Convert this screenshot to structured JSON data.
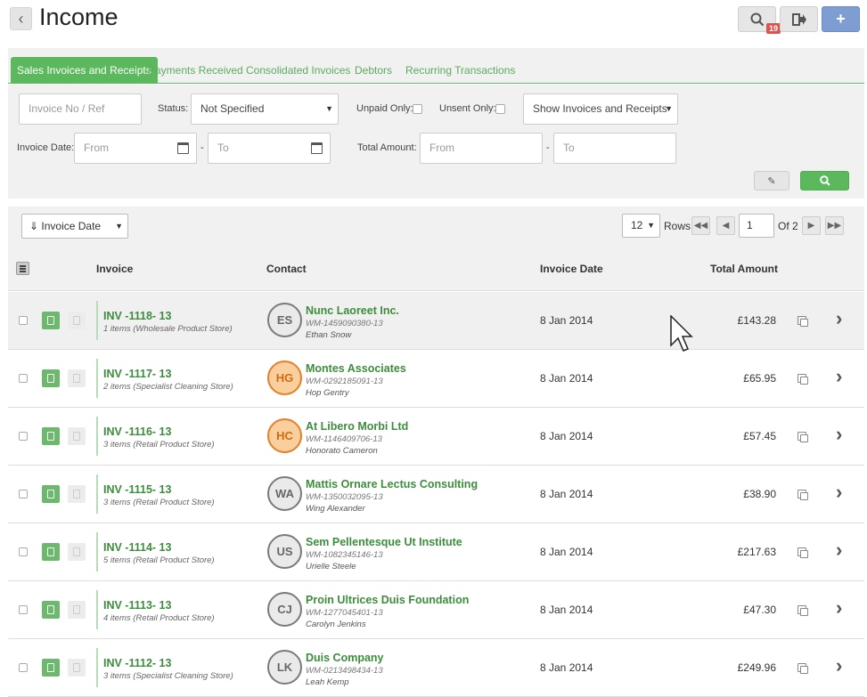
{
  "page": {
    "title": "Income",
    "badge_count": "19",
    "add_label": "+"
  },
  "tabs": [
    {
      "label": "Sales Invoices and Receipts",
      "active": true
    },
    {
      "label": "Payments Received"
    },
    {
      "label": "Consolidated Invoices"
    },
    {
      "label": "Debtors"
    },
    {
      "label": "Recurring Transactions"
    }
  ],
  "filters": {
    "invoice_placeholder": "Invoice No / Ref",
    "status_label": "Status:",
    "status_value": "Not Specified",
    "unpaid_label": "Unpaid Only:",
    "unsent_label": "Unsent Only:",
    "show_value": "Show Invoices and Receipts",
    "invoice_date_label": "Invoice Date:",
    "from_placeholder": "From",
    "to_placeholder": "To",
    "dash": "-",
    "total_amount_label": "Total Amount:"
  },
  "list": {
    "sort_value": "⇓ Invoice Date",
    "rows_value": "12",
    "rows_label": "Rows",
    "page_value": "1",
    "of_label": "Of 2",
    "headers": {
      "invoice": "Invoice",
      "contact": "Contact",
      "invoice_date": "Invoice Date",
      "total_amount": "Total Amount"
    }
  },
  "invoices": [
    {
      "number": "INV -1118- 13",
      "items": "1 items (Wholesale Product Store)",
      "initials": "ES",
      "avatar_color": "grey",
      "company": "Nunc Laoreet Inc.",
      "ref": "WM-1459090380-13",
      "person": "Ethan Snow",
      "date": "8 Jan 2014",
      "amount": "£143.28"
    },
    {
      "number": "INV -1117- 13",
      "items": "2 items (Specialist Cleaning Store)",
      "initials": "HG",
      "avatar_color": "orange",
      "company": "Montes Associates",
      "ref": "WM-0292185091-13",
      "person": "Hop Gentry",
      "date": "8 Jan 2014",
      "amount": "£65.95"
    },
    {
      "number": "INV -1116- 13",
      "items": "3 items (Retail Product Store)",
      "initials": "HC",
      "avatar_color": "orange",
      "company": "At Libero Morbi Ltd",
      "ref": "WM-1146409706-13",
      "person": "Honorato Cameron",
      "date": "8 Jan 2014",
      "amount": "£57.45"
    },
    {
      "number": "INV -1115- 13",
      "items": "3 items (Retail Product Store)",
      "initials": "WA",
      "avatar_color": "grey",
      "company": "Mattis Ornare Lectus Consulting",
      "ref": "WM-1350032095-13",
      "person": "Wing Alexander",
      "date": "8 Jan 2014",
      "amount": "£38.90"
    },
    {
      "number": "INV -1114- 13",
      "items": "5 items (Retail Product Store)",
      "initials": "US",
      "avatar_color": "grey",
      "company": "Sem Pellentesque Ut Institute",
      "ref": "WM-1082345146-13",
      "person": "Urielle Steele",
      "date": "8 Jan 2014",
      "amount": "£217.63"
    },
    {
      "number": "INV -1113- 13",
      "items": "4 items (Retail Product Store)",
      "initials": "CJ",
      "avatar_color": "grey",
      "company": "Proin Ultrices Duis Foundation",
      "ref": "WM-1277045401-13",
      "person": "Carolyn Jenkins",
      "date": "8 Jan 2014",
      "amount": "£47.30"
    },
    {
      "number": "INV -1112- 13",
      "items": "3 items (Specialist Cleaning Store)",
      "initials": "LK",
      "avatar_color": "grey",
      "company": "Duis Company",
      "ref": "WM-0213498434-13",
      "person": "Leah Kemp",
      "date": "8 Jan 2014",
      "amount": "£249.96"
    }
  ]
}
